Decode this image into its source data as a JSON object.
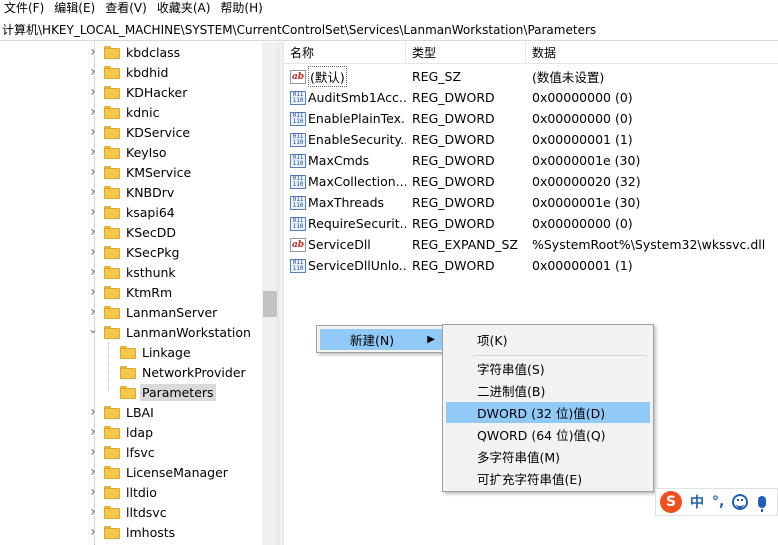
{
  "menubar": {
    "items": [
      "文件(F)",
      "编辑(E)",
      "查看(V)",
      "收藏夹(A)",
      "帮助(H)"
    ]
  },
  "address": {
    "path": "计算机\\HKEY_LOCAL_MACHINE\\SYSTEM\\CurrentControlSet\\Services\\LanmanWorkstation\\Parameters"
  },
  "tree": {
    "items": [
      {
        "label": "kbdclass",
        "level": 0,
        "expander": "collapsed"
      },
      {
        "label": "kbdhid",
        "level": 0,
        "expander": "collapsed"
      },
      {
        "label": "KDHacker",
        "level": 0,
        "expander": "collapsed"
      },
      {
        "label": "kdnic",
        "level": 0,
        "expander": "collapsed"
      },
      {
        "label": "KDService",
        "level": 0,
        "expander": "collapsed"
      },
      {
        "label": "KeyIso",
        "level": 0,
        "expander": "collapsed"
      },
      {
        "label": "KMService",
        "level": 0,
        "expander": "collapsed"
      },
      {
        "label": "KNBDrv",
        "level": 0,
        "expander": "collapsed"
      },
      {
        "label": "ksapi64",
        "level": 0,
        "expander": "collapsed"
      },
      {
        "label": "KSecDD",
        "level": 0,
        "expander": "collapsed"
      },
      {
        "label": "KSecPkg",
        "level": 0,
        "expander": "collapsed"
      },
      {
        "label": "ksthunk",
        "level": 0,
        "expander": "collapsed"
      },
      {
        "label": "KtmRm",
        "level": 0,
        "expander": "collapsed"
      },
      {
        "label": "LanmanServer",
        "level": 0,
        "expander": "collapsed"
      },
      {
        "label": "LanmanWorkstation",
        "level": 0,
        "expander": "expanded"
      },
      {
        "label": "Linkage",
        "level": 1,
        "expander": "none"
      },
      {
        "label": "NetworkProvider",
        "level": 1,
        "expander": "none"
      },
      {
        "label": "Parameters",
        "level": 1,
        "expander": "none",
        "selected": true
      },
      {
        "label": "LBAI",
        "level": 0,
        "expander": "collapsed"
      },
      {
        "label": "ldap",
        "level": 0,
        "expander": "collapsed"
      },
      {
        "label": "lfsvc",
        "level": 0,
        "expander": "collapsed"
      },
      {
        "label": "LicenseManager",
        "level": 0,
        "expander": "collapsed"
      },
      {
        "label": "lltdio",
        "level": 0,
        "expander": "collapsed"
      },
      {
        "label": "lltdsvc",
        "level": 0,
        "expander": "collapsed"
      },
      {
        "label": "lmhosts",
        "level": 0,
        "expander": "collapsed"
      }
    ]
  },
  "list": {
    "headers": {
      "name": "名称",
      "type": "类型",
      "data": "数据"
    },
    "rows": [
      {
        "name": "(默认)",
        "type": "REG_SZ",
        "data": "(数值未设置)",
        "icon": "string-value-icon",
        "selected": true
      },
      {
        "name": "AuditSmb1Acc...",
        "type": "REG_DWORD",
        "data": "0x00000000 (0)",
        "icon": "binary-value-icon"
      },
      {
        "name": "EnablePlainTex...",
        "type": "REG_DWORD",
        "data": "0x00000000 (0)",
        "icon": "binary-value-icon"
      },
      {
        "name": "EnableSecurity...",
        "type": "REG_DWORD",
        "data": "0x00000001 (1)",
        "icon": "binary-value-icon"
      },
      {
        "name": "MaxCmds",
        "type": "REG_DWORD",
        "data": "0x0000001e (30)",
        "icon": "binary-value-icon"
      },
      {
        "name": "MaxCollection...",
        "type": "REG_DWORD",
        "data": "0x00000020 (32)",
        "icon": "binary-value-icon"
      },
      {
        "name": "MaxThreads",
        "type": "REG_DWORD",
        "data": "0x0000001e (30)",
        "icon": "binary-value-icon"
      },
      {
        "name": "RequireSecurit...",
        "type": "REG_DWORD",
        "data": "0x00000000 (0)",
        "icon": "binary-value-icon"
      },
      {
        "name": "ServiceDll",
        "type": "REG_EXPAND_SZ",
        "data": "%SystemRoot%\\System32\\wkssvc.dll",
        "icon": "string-value-icon"
      },
      {
        "name": "ServiceDllUnlo...",
        "type": "REG_DWORD",
        "data": "0x00000001 (1)",
        "icon": "binary-value-icon"
      }
    ]
  },
  "context_menu": {
    "new_label": "新建(N)",
    "submenu": {
      "key": "项(K)",
      "items": [
        {
          "label": "字符串值(S)"
        },
        {
          "label": "二进制值(B)"
        },
        {
          "label": "DWORD (32 位)值(D)",
          "highlighted": true
        },
        {
          "label": "QWORD (64 位)值(Q)"
        },
        {
          "label": "多字符串值(M)"
        },
        {
          "label": "可扩充字符串值(E)"
        }
      ]
    }
  },
  "ime": {
    "logo": "S",
    "mode": "中",
    "punct": "°,"
  }
}
